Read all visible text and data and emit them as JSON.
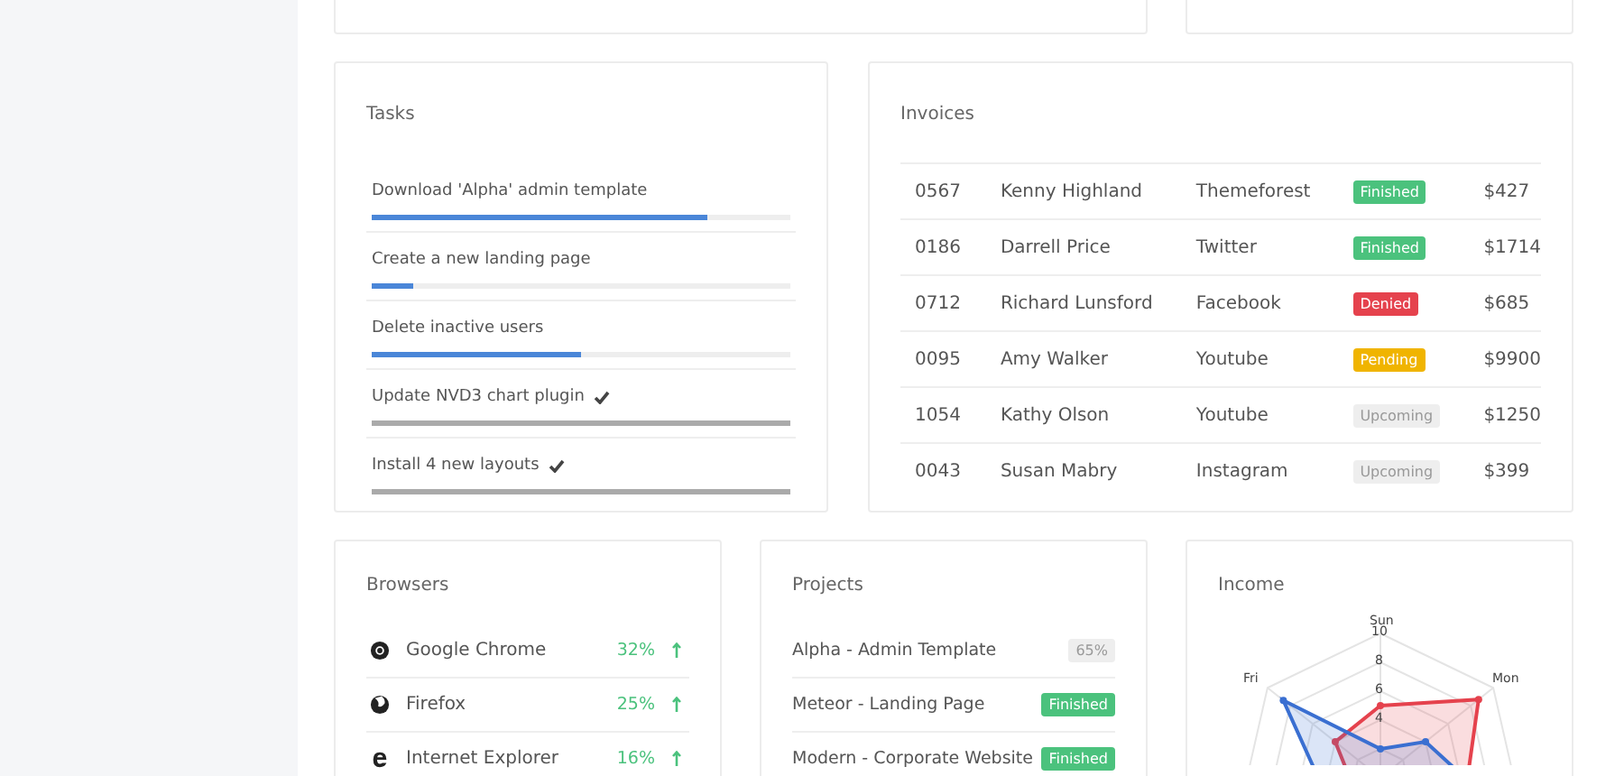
{
  "tasks": {
    "title": "Tasks",
    "items": [
      {
        "label": "Download 'Alpha' admin template",
        "level": 0.8,
        "done": false
      },
      {
        "label": "Create a new landing page",
        "level": 0.1,
        "done": false
      },
      {
        "label": "Delete inactive users",
        "level": 0.5,
        "done": false
      },
      {
        "label": "Update NVD3 chart plugin",
        "level": 1,
        "done": true
      },
      {
        "label": "Install 4 new layouts",
        "level": 1,
        "done": true
      }
    ]
  },
  "invoices": {
    "title": "Invoices",
    "rows": [
      {
        "number": "0567",
        "name": "Kenny Highland",
        "source": "Themeforest",
        "status": "Finished",
        "kind": "finished",
        "amount": "$427"
      },
      {
        "number": "0186",
        "name": "Darrell Price",
        "source": "Twitter",
        "status": "Finished",
        "kind": "finished",
        "amount": "$1714"
      },
      {
        "number": "0712",
        "name": "Richard Lunsford",
        "source": "Facebook",
        "status": "Denied",
        "kind": "denied",
        "amount": "$685"
      },
      {
        "number": "0095",
        "name": "Amy Walker",
        "source": "Youtube",
        "status": "Pending",
        "kind": "pending",
        "amount": "$9900"
      },
      {
        "number": "1054",
        "name": "Kathy Olson",
        "source": "Youtube",
        "status": "Upcoming",
        "kind": "upcoming",
        "amount": "$1250"
      },
      {
        "number": "0043",
        "name": "Susan Mabry",
        "source": "Instagram",
        "status": "Upcoming",
        "kind": "upcoming",
        "amount": "$399"
      }
    ]
  },
  "browsers": {
    "title": "Browsers",
    "items": [
      {
        "name": "Google Chrome",
        "kind": "chrome",
        "share": "32%"
      },
      {
        "name": "Firefox",
        "kind": "firefox",
        "share": "25%"
      },
      {
        "name": "Internet Explorer",
        "kind": "ie",
        "share": "16%"
      }
    ]
  },
  "projects": {
    "title": "Projects",
    "items": [
      {
        "name": "Alpha - Admin Template",
        "badge": "65%",
        "kind": "progress"
      },
      {
        "name": "Meteor - Landing Page",
        "badge": "Finished",
        "kind": "finished"
      },
      {
        "name": "Modern - Corporate Website",
        "badge": "Finished",
        "kind": "finished"
      }
    ]
  },
  "income": {
    "title": "Income",
    "axis_labels": [
      "Sun",
      "Mon",
      "Fri"
    ],
    "scale_labels": [
      "10",
      "8",
      "6",
      "4"
    ]
  }
}
